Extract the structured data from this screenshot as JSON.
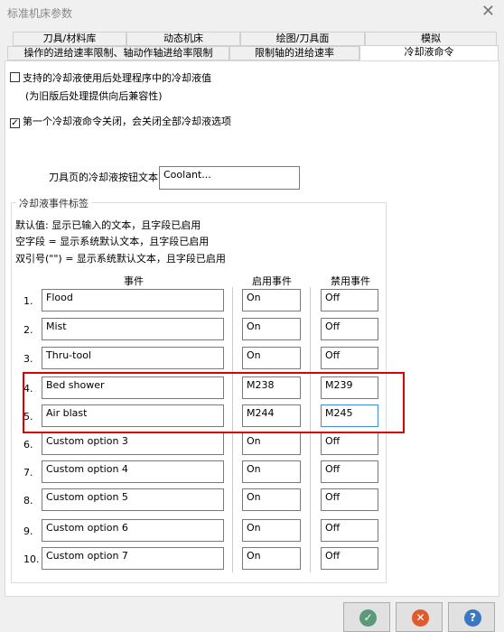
{
  "window": {
    "title": "标准机床参数",
    "close_icon": "close-icon"
  },
  "tabs_row1": [
    "刀具/材料库",
    "动态机床",
    "绘图/刀具面",
    "模拟"
  ],
  "tabs_row2": [
    "操作的进给速率限制、轴动作轴进给率限制",
    "限制轴的进给速率",
    "冷却液命令"
  ],
  "active_tab": "冷却液命令",
  "options": {
    "support_coolant": {
      "label": "支持的冷却液使用后处理程序中的冷却液值",
      "checked": false,
      "note": "(为旧版后处理提供向后兼容性)"
    },
    "first_off": {
      "label": "第一个冷却液命令关闭，会关闭全部冷却液选项",
      "checked": true
    }
  },
  "button_text": {
    "label": "刀具页的冷却液按钮文本:",
    "value": "Coolant..."
  },
  "group": {
    "title": "冷却液事件标签",
    "help": [
      "默认值: 显示已输入的文本，且字段已启用",
      "空字段 = 显示系统默认文本，且字段已启用",
      "双引号(\"\") = 显示系统默认文本，且字段已启用"
    ],
    "headers": {
      "event": "事件",
      "on": "启用事件",
      "off": "禁用事件"
    },
    "rows": [
      {
        "num": "1.",
        "event": "Flood",
        "on": "On",
        "off": "Off"
      },
      {
        "num": "2.",
        "event": "Mist",
        "on": "On",
        "off": "Off"
      },
      {
        "num": "3.",
        "event": "Thru-tool",
        "on": "On",
        "off": "Off"
      },
      {
        "num": "4.",
        "event": "Bed shower",
        "on": "M238",
        "off": "M239"
      },
      {
        "num": "5.",
        "event": "Air blast",
        "on": "M244",
        "off": "M245"
      },
      {
        "num": "6.",
        "event": "Custom option 3",
        "on": "On",
        "off": "Off"
      },
      {
        "num": "7.",
        "event": "Custom option 4",
        "on": "On",
        "off": "Off"
      },
      {
        "num": "8.",
        "event": "Custom option 5",
        "on": "On",
        "off": "Off"
      },
      {
        "num": "9.",
        "event": "Custom option 6",
        "on": "On",
        "off": "Off"
      },
      {
        "num": "10.",
        "event": "Custom option 7",
        "on": "On",
        "off": "Off"
      }
    ]
  },
  "highlight_color": "#e00000",
  "buttons": [
    {
      "name": "ok",
      "icon": "check-icon",
      "color": "#5a9a78"
    },
    {
      "name": "cancel",
      "icon": "x-icon",
      "color": "#e05a2c"
    },
    {
      "name": "help",
      "icon": "question-icon",
      "color": "#3c78c0"
    }
  ]
}
